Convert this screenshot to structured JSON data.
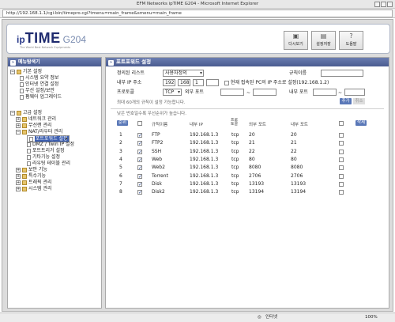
{
  "window": {
    "title": "EFM Networks ipTIME G204 - Microsoft Internet Explorer"
  },
  "address": {
    "url": "http://192.168.1.1/cgi-bin/timepro.cgi?tmenu=main_frame&smenu=main_frame"
  },
  "header": {
    "logo_ip": "ip",
    "logo_time": "TIME",
    "logo_model": "G204",
    "tagline": "The World Best Network Equipments",
    "buttons": [
      {
        "icon": "refresh-icon",
        "label": "다시보기"
      },
      {
        "icon": "save-icon",
        "label": "설정저장"
      },
      {
        "icon": "help-icon",
        "label": "도움말"
      }
    ]
  },
  "sidebar": {
    "title": "메뉴탐색기",
    "items": [
      {
        "label": "기본 설정",
        "type": "folder"
      },
      {
        "label": "시스템 요약 정보",
        "type": "page"
      },
      {
        "label": "인터넷 연결 설정",
        "type": "page"
      },
      {
        "label": "무선 설정/보안",
        "type": "page"
      },
      {
        "label": "펌웨어 업그레이드",
        "type": "page"
      },
      {
        "label": "고급 설정",
        "type": "folder"
      },
      {
        "label": "네트워크 관리",
        "type": "folder"
      },
      {
        "label": "무선랜 관리",
        "type": "folder"
      },
      {
        "label": "NAT/라우터 관리",
        "type": "folder"
      },
      {
        "label": "포트포워드 설정",
        "type": "page",
        "selected": true
      },
      {
        "label": "DMZ / Twin IP 설정",
        "type": "page"
      },
      {
        "label": "포트트리거 설정",
        "type": "page"
      },
      {
        "label": "기타기능 설정",
        "type": "page"
      },
      {
        "label": "라우팅 테이블 관리",
        "type": "page"
      },
      {
        "label": "보안 기능",
        "type": "folder"
      },
      {
        "label": "특수기능",
        "type": "folder"
      },
      {
        "label": "트래픽 관리",
        "type": "folder"
      },
      {
        "label": "시스템 관리",
        "type": "folder"
      }
    ]
  },
  "panel": {
    "title": "포트포워드 설정",
    "form": {
      "rule_list_label": "정의된 리스트",
      "rule_list_value": "사용자정의",
      "rule_name_label": "규칙이름",
      "rule_name_value": "",
      "internal_ip_label": "내부 IP 주소",
      "ip1": "192",
      "ip2": "168",
      "ip3": "1",
      "ip4": "",
      "current_pc_label": "현재 접속된 PC의 IP 주소로 설정(192.168.1.2)",
      "protocol_label": "프로토콜",
      "protocol_value": "TCP",
      "external_port_label": "외부 포트",
      "internal_port_label": "내부 포트",
      "range_sep": "~",
      "note": "최대 60개의 규칙이 설정 가능합니다.",
      "add_button": "추가",
      "cancel_button": "취소"
    },
    "priority_note": "낮은 번호일수록 우선순위가 높습니다.",
    "table": {
      "headers": {
        "order": "순위",
        "name": "규칙이름",
        "ip": "내부 IP",
        "proto": "프로토콜",
        "ext": "외부 포트",
        "int": "내부 포트",
        "delete": "삭제"
      },
      "order_chip": "순위",
      "rows": [
        {
          "num": "1",
          "checked": true,
          "name": "FTP",
          "ip": "192.168.1.3",
          "proto": "tcp",
          "ext": "20",
          "int": "20"
        },
        {
          "num": "2",
          "checked": true,
          "name": "FTP2",
          "ip": "192.168.1.3",
          "proto": "tcp",
          "ext": "21",
          "int": "21"
        },
        {
          "num": "3",
          "checked": true,
          "name": "SSH",
          "ip": "192.168.1.3",
          "proto": "tcp",
          "ext": "22",
          "int": "22"
        },
        {
          "num": "4",
          "checked": true,
          "name": "Web",
          "ip": "192.168.1.3",
          "proto": "tcp",
          "ext": "80",
          "int": "80"
        },
        {
          "num": "5",
          "checked": true,
          "name": "Web2",
          "ip": "192.168.1.3",
          "proto": "tcp",
          "ext": "8080",
          "int": "8080"
        },
        {
          "num": "6",
          "checked": true,
          "name": "Torrent",
          "ip": "192.168.1.3",
          "proto": "tcp",
          "ext": "2706",
          "int": "2706"
        },
        {
          "num": "7",
          "checked": true,
          "name": "Disk",
          "ip": "192.168.1.3",
          "proto": "tcp",
          "ext": "13193",
          "int": "13193"
        },
        {
          "num": "8",
          "checked": true,
          "name": "Disk2",
          "ip": "192.168.1.3",
          "proto": "tcp",
          "ext": "13194",
          "int": "13194"
        }
      ]
    }
  },
  "status": {
    "zone": "인터넷",
    "zoom": "100%"
  },
  "colors": {
    "accent": "#4a5c90",
    "selected": "#3d5fb0"
  }
}
